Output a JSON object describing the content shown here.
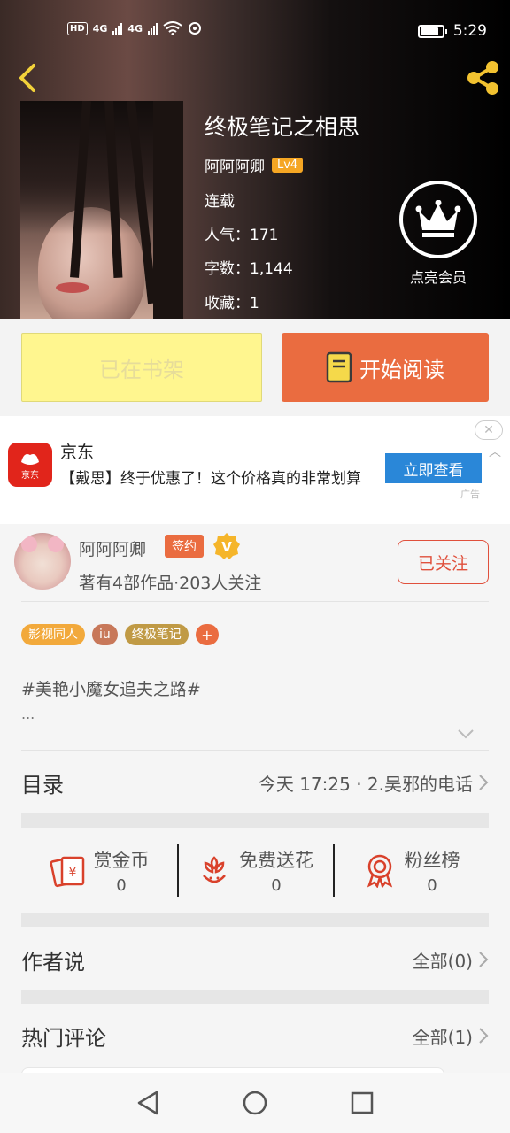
{
  "status_bar": {
    "time": "5:29",
    "hd_label": "HD",
    "net1": "4G",
    "net2": "4G",
    "battery_level": 0.85
  },
  "book": {
    "title": "终极笔记之相思",
    "author": "阿阿阿卿",
    "author_level": "Lv4",
    "status": "连载",
    "popularity": "人气：171",
    "word_count": "字数：1,144",
    "favorites": "收藏：1"
  },
  "vip": {
    "label": "点亮会员"
  },
  "actions": {
    "shelf_label": "已在书架",
    "read_label": "开始阅读"
  },
  "ad": {
    "brand": "京东",
    "logo_text": "京东",
    "description": "【戴思】终于优惠了！这个价格真的非常划算",
    "button": "立即查看",
    "close": "✕",
    "tag": "广告"
  },
  "author_card": {
    "name": "阿阿阿卿",
    "sign_badge": "签约",
    "verified_letter": "V",
    "subtitle": "著有4部作品·203人关注",
    "follow_label": "已关注"
  },
  "tags": [
    {
      "label": "影视同人",
      "color": "#f2a93b"
    },
    {
      "label": "iu",
      "color": "#c8785a"
    },
    {
      "label": "终极笔记",
      "color": "#c09a45"
    }
  ],
  "tag_add": "+",
  "intro": {
    "text": "#美艳小魔女追夫之路#",
    "more": "..."
  },
  "catalog": {
    "title": "目录",
    "latest": "今天 17:25 · 2.吴邪的电话"
  },
  "stats": [
    {
      "label": "赏金币",
      "count": "0",
      "icon": "red-envelope-icon"
    },
    {
      "label": "免费送花",
      "count": "0",
      "icon": "flower-icon"
    },
    {
      "label": "粉丝榜",
      "count": "0",
      "icon": "medal-icon"
    }
  ],
  "author_says": {
    "title": "作者说",
    "link": "全部(0)"
  },
  "hot_comments": {
    "title": "热门评论",
    "link": "全部(1)"
  },
  "colors": {
    "accent_orange": "#ea6c40",
    "shelf_yellow": "#fff68f",
    "follow_red": "#e0503c",
    "icon_red": "#d9412b",
    "share_yellow": "#f2c230"
  }
}
